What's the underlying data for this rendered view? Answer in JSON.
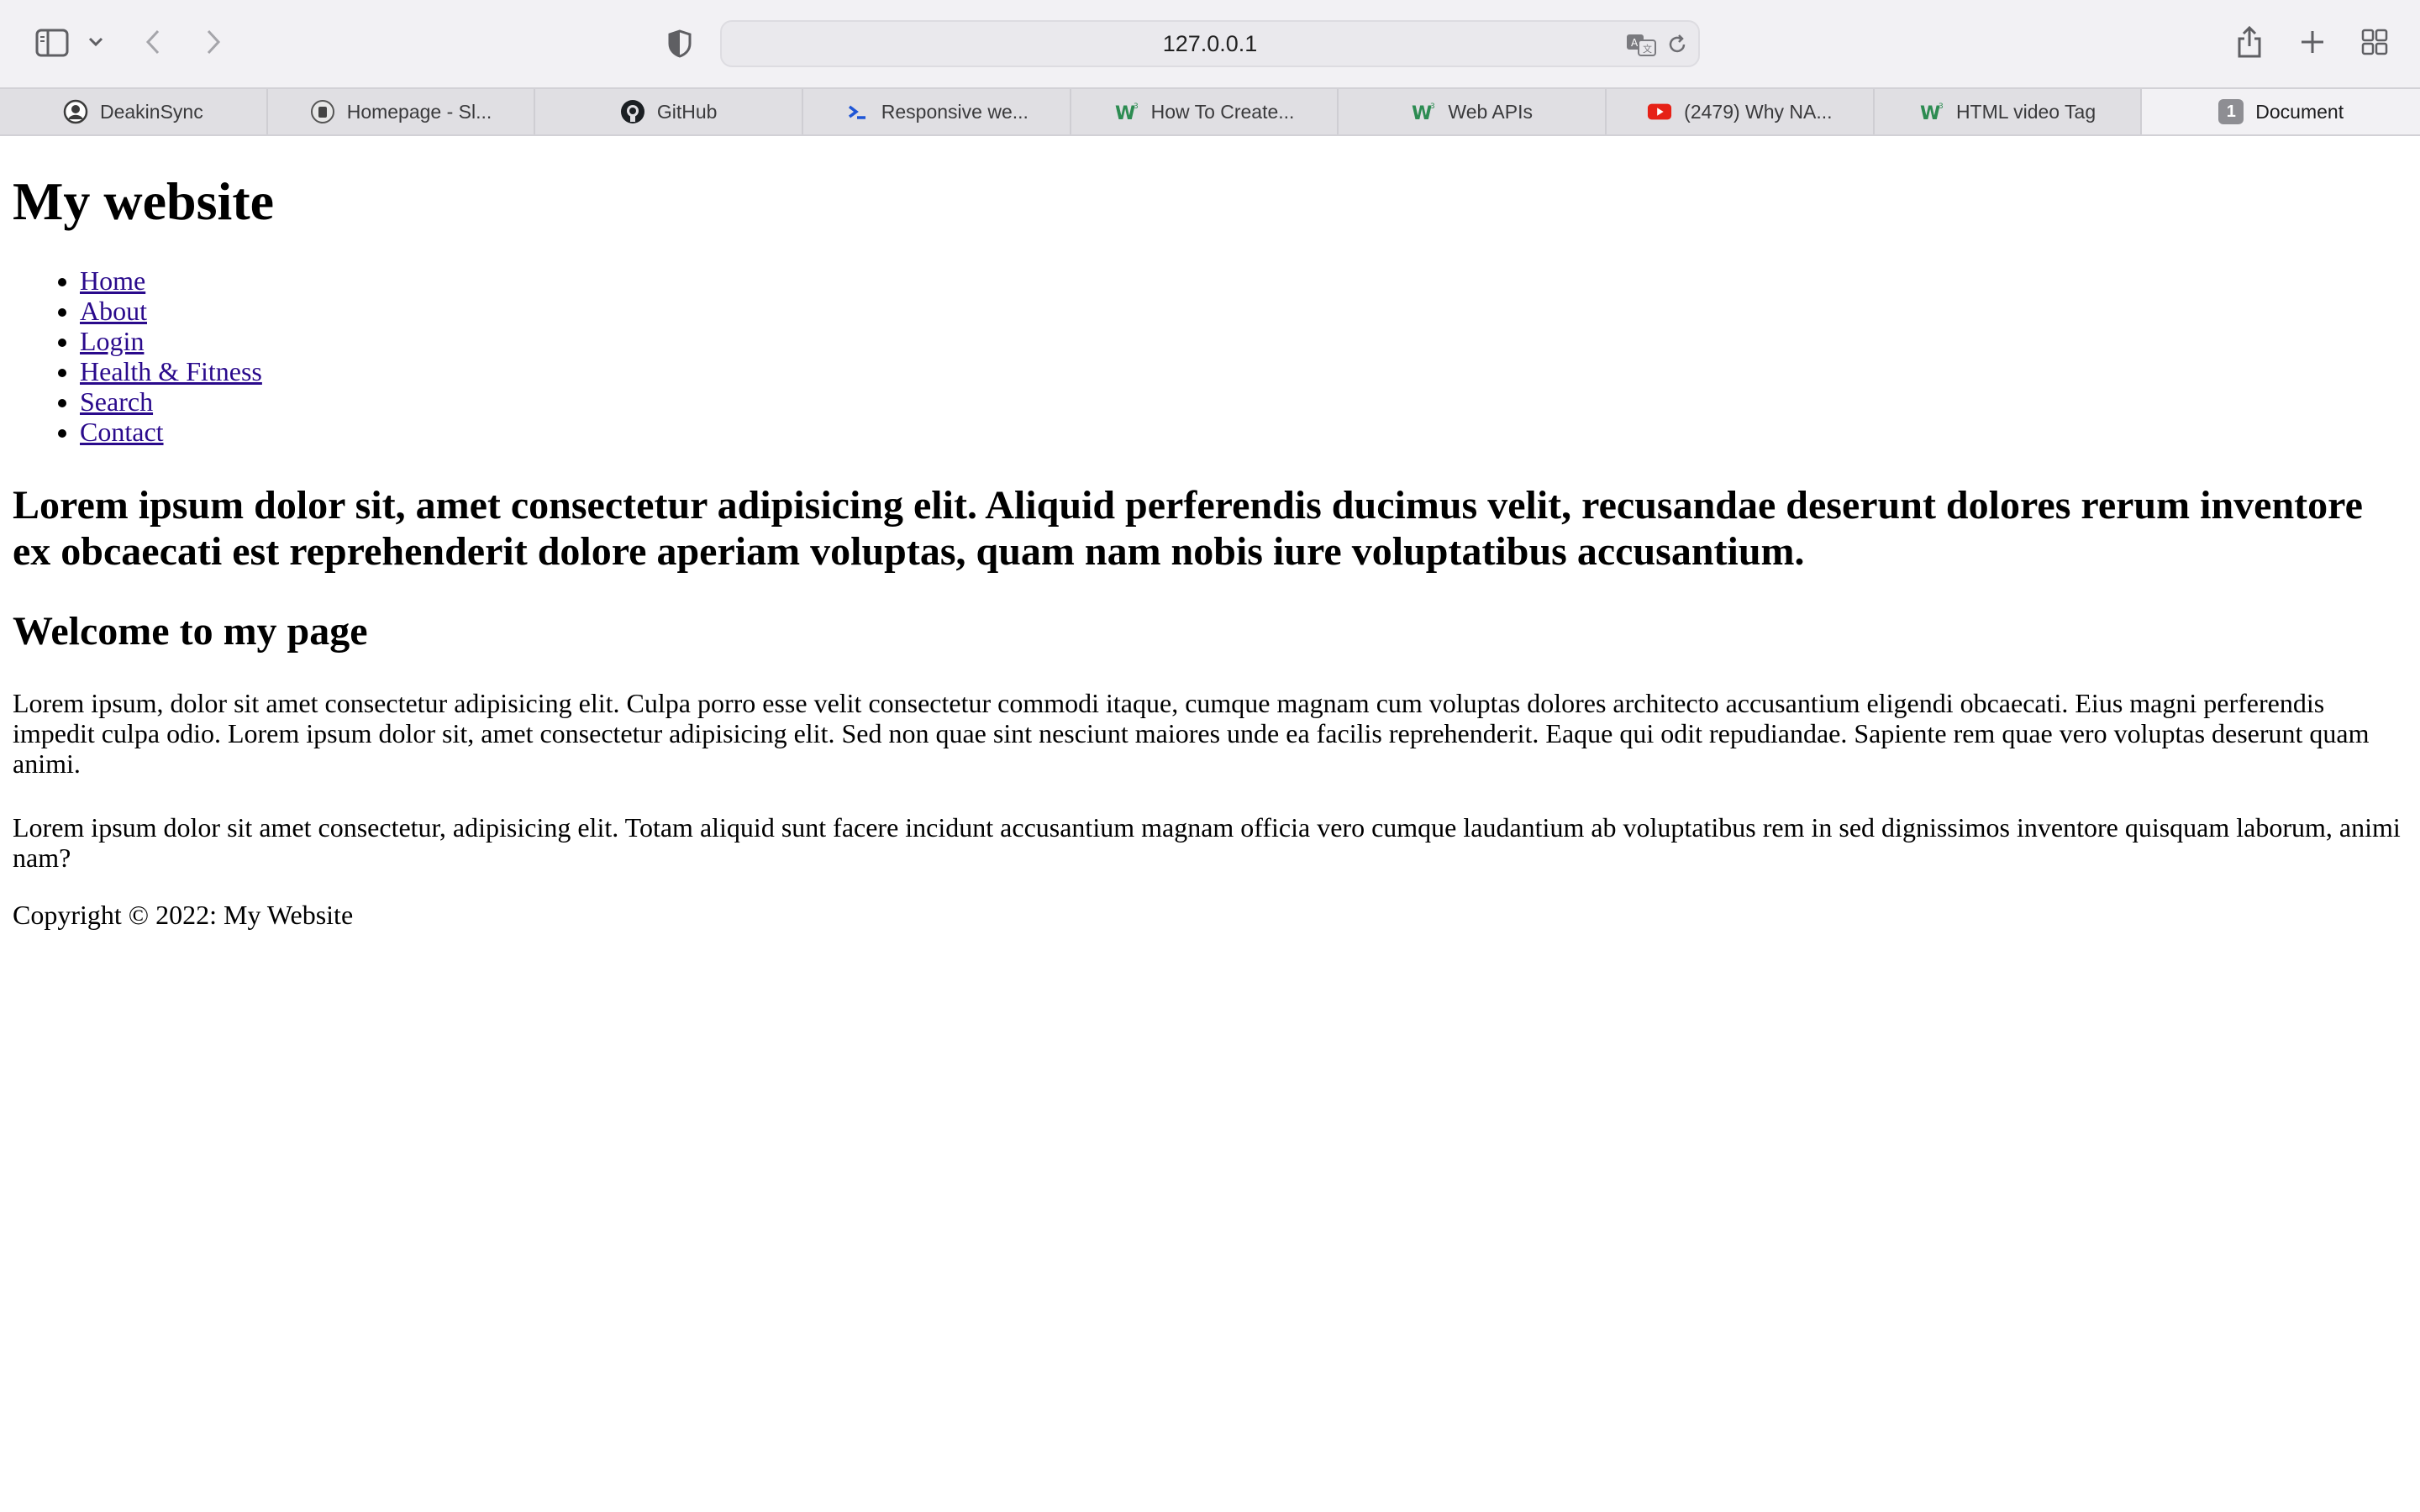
{
  "browser": {
    "address": "127.0.0.1",
    "tabs": [
      {
        "label": "DeakinSync",
        "icon": "deakin-icon"
      },
      {
        "label": "Homepage - Sl...",
        "icon": "homepage-icon"
      },
      {
        "label": "GitHub",
        "icon": "github-icon"
      },
      {
        "label": "Responsive we...",
        "icon": "terminal-prompt-icon"
      },
      {
        "label": "How To Create...",
        "icon": "w3schools-icon"
      },
      {
        "label": "Web APIs",
        "icon": "w3schools-icon"
      },
      {
        "label": "(2479) Why NA...",
        "icon": "youtube-icon"
      },
      {
        "label": "HTML video Tag",
        "icon": "w3schools-icon"
      },
      {
        "label": "Document",
        "icon": "number-badge-icon",
        "badge": "1"
      }
    ]
  },
  "page": {
    "title": "My website",
    "nav": [
      "Home",
      "About",
      "Login",
      "Health & Fitness",
      "Search",
      "Contact"
    ],
    "lead": "Lorem ipsum dolor sit, amet consectetur adipisicing elit. Aliquid perferendis ducimus velit, recusandae deserunt dolores rerum inventore ex obcaecati est reprehenderit dolore aperiam voluptas, quam nam nobis iure voluptatibus accusantium.",
    "welcome": "Welcome to my page",
    "paragraphs": [
      "Lorem ipsum, dolor sit amet consectetur adipisicing elit. Culpa porro esse velit consectetur commodi itaque, cumque magnam cum voluptas dolores architecto accusantium eligendi obcaecati. Eius magni perferendis impedit culpa odio. Lorem ipsum dolor sit, amet consectetur adipisicing elit. Sed non quae sint nesciunt maiores unde ea facilis reprehenderit. Eaque qui odit repudiandae. Sapiente rem quae vero voluptas deserunt quam animi.",
      "Lorem ipsum dolor sit amet consectetur, adipisicing elit. Totam aliquid sunt facere incidunt accusantium magnam officia vero cumque laudantium ab voluptatibus rem in sed dignissimos inventore quisquam laborum, animi nam?"
    ],
    "copyright": "Copyright © 2022: My Website"
  }
}
